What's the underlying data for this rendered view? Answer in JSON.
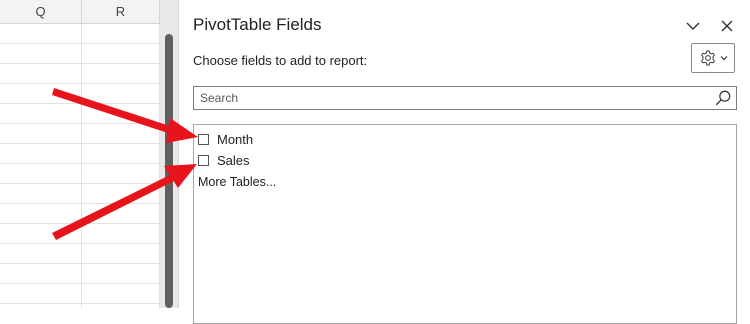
{
  "sheet": {
    "columns": [
      "Q",
      "R"
    ]
  },
  "pane": {
    "title": "PivotTable Fields",
    "choose_label": "Choose fields to add to report:",
    "gear_icon": "gear-icon",
    "search": {
      "placeholder": "Search",
      "value": ""
    },
    "fields": [
      {
        "label": "Month",
        "checked": false
      },
      {
        "label": "Sales",
        "checked": false
      }
    ],
    "more_tables": "More Tables..."
  },
  "annotation": {
    "arrow_color": "#e8141b"
  }
}
